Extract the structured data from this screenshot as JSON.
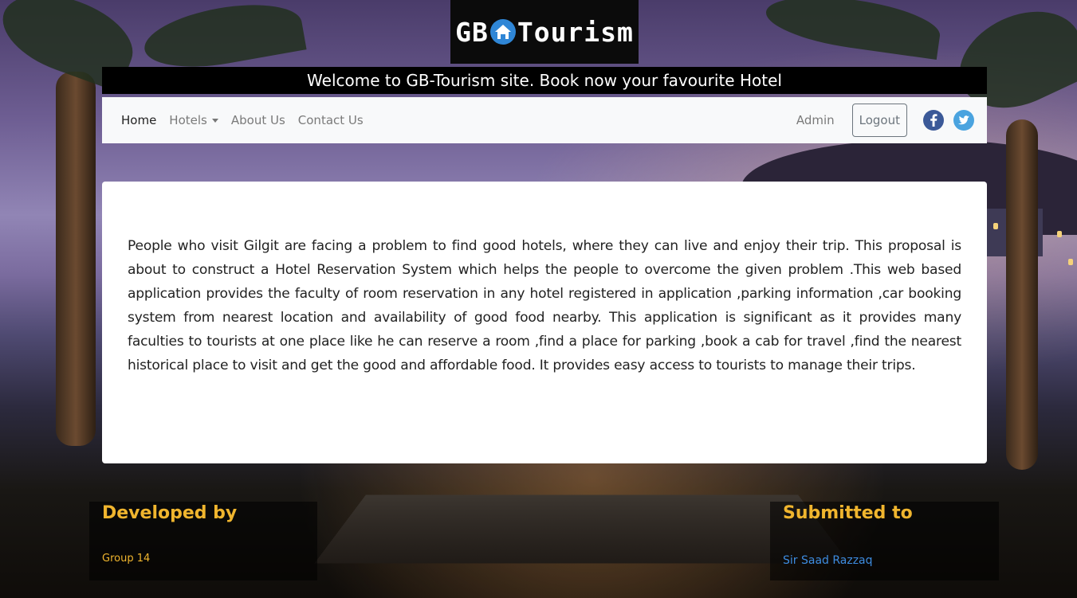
{
  "logo": {
    "text_left": "GB",
    "text_right": "Tourism",
    "icon": "house-icon"
  },
  "welcome": {
    "text": "Welcome to GB-Tourism site. Book now your favourite Hotel"
  },
  "nav": {
    "items": [
      {
        "label": "Home"
      },
      {
        "label": "Hotels"
      },
      {
        "label": "About Us"
      },
      {
        "label": "Contact Us"
      }
    ],
    "admin_label": "Admin",
    "logout_label": "Logout",
    "social": [
      "facebook-icon",
      "twitter-icon"
    ]
  },
  "content": {
    "paragraph": "People who visit Gilgit are facing a problem to find good hotels, where they can live and enjoy their trip. This proposal is about to construct a Hotel Reservation System which helps the people to overcome the given problem .This web based application provides the faculty of room reservation in any hotel registered in application ,parking information ,car booking system from nearest location and availability of good food nearby. This application is significant as it provides many faculties to tourists at one place like he can reserve a room ,find a place for parking ,book a cab for travel ,find the nearest historical place to visit and get the good and affordable food. It provides easy access to tourists to manage their trips."
  },
  "footer": {
    "developed_heading": "Developed by",
    "developed_text": "Group 14",
    "submitted_heading": "Submitted to",
    "submitted_text": "Sir Saad Razzaq"
  },
  "colors": {
    "accent_heading": "#f0b52e",
    "link_blue": "#3d8ce0",
    "facebook": "#3b5998",
    "twitter": "#4aa3df"
  }
}
